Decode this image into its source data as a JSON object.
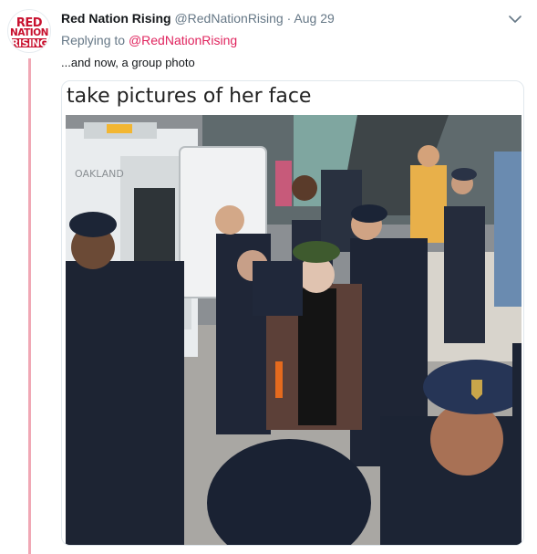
{
  "tweet": {
    "avatar_text": [
      "RED",
      "NATION",
      "RISING"
    ],
    "display_name": "Red Nation Rising",
    "handle": "@RedNationRising",
    "separator": "·",
    "date": "Aug 29",
    "replying_prefix": "Replying to",
    "replying_mention": "@RedNationRising",
    "text": "...and now, a group photo",
    "menu_icon": "chevron-down-icon"
  },
  "media": {
    "caption": "take pictures of her face",
    "photo_text": {
      "van_lettering": "OAKLAND"
    }
  },
  "colors": {
    "accent": "#e0245e",
    "thread_line": "#f0a8b5",
    "muted": "#657786",
    "brand_red": "#c8102e"
  }
}
